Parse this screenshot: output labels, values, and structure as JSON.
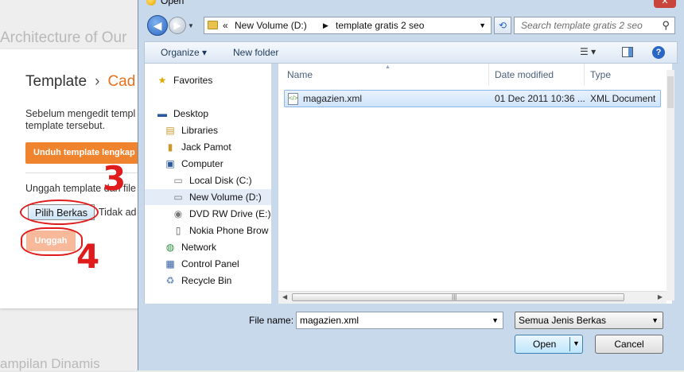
{
  "background": {
    "header_text": "Architecture of Our",
    "breadcrumb_root": "Template",
    "breadcrumb_sep": "›",
    "breadcrumb_current": "Cad",
    "description": "Sebelum mengedit templ template tersebut.",
    "download_button": "Unduh template lengkap",
    "upload_label": "Unggah template dari file",
    "choose_file_button": "Pilih Berkas",
    "no_file_text": "Tidak ad",
    "upload_button": "Unggah",
    "step3": "3",
    "step4": "4",
    "footer_text": "ampilan Dinamis"
  },
  "dialog": {
    "title": "Open",
    "address": {
      "chevron": "«",
      "segment1": "New Volume (D:)",
      "segment2": "template gratis 2 seo"
    },
    "search_placeholder": "Search template gratis 2 seo",
    "toolbar": {
      "organize": "Organize ▾",
      "new_folder": "New folder",
      "views": "☰ ▾"
    },
    "nav_items": [
      {
        "label": "Favorites",
        "icon": "star-icon"
      },
      {
        "label": "Desktop",
        "icon": "desktop-icon"
      },
      {
        "label": "Libraries",
        "icon": "libraries-icon"
      },
      {
        "label": "Jack Pamot",
        "icon": "user-folder-icon"
      },
      {
        "label": "Computer",
        "icon": "computer-icon"
      },
      {
        "label": "Local Disk (C:)",
        "icon": "disk-icon"
      },
      {
        "label": "New Volume (D:)",
        "icon": "disk-icon"
      },
      {
        "label": "DVD RW Drive (E:)",
        "icon": "dvd-icon"
      },
      {
        "label": "Nokia Phone Brow",
        "icon": "phone-icon"
      },
      {
        "label": "Network",
        "icon": "network-icon"
      },
      {
        "label": "Control Panel",
        "icon": "control-panel-icon"
      },
      {
        "label": "Recycle Bin",
        "icon": "recycle-bin-icon"
      }
    ],
    "columns": {
      "name": "Name",
      "date": "Date modified",
      "type": "Type"
    },
    "files": [
      {
        "name": "magazien.xml",
        "date": "01 Dec 2011 10:36 ...",
        "type": "XML Document"
      }
    ],
    "filename_label": "File name:",
    "filename_value": "magazien.xml",
    "filetype_value": "Semua Jenis Berkas",
    "open_button": "Open",
    "cancel_button": "Cancel"
  }
}
